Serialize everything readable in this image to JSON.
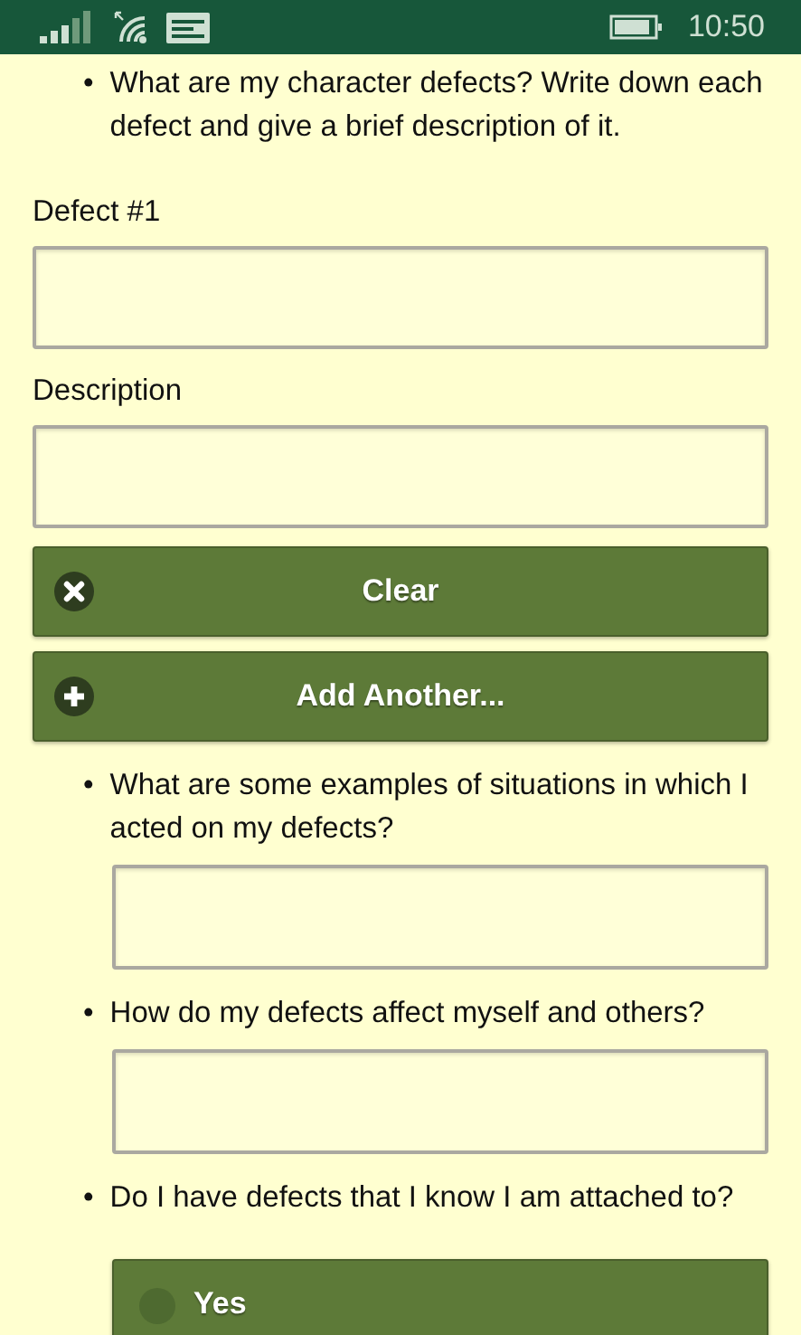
{
  "status_bar": {
    "time": "10:50"
  },
  "intro": {
    "bullet": "•",
    "text": "What are my character defects? Write down each defect and give a brief description of it."
  },
  "fields": [
    {
      "label": "Defect #1"
    },
    {
      "label": "Description"
    }
  ],
  "buttons": [
    {
      "kind": "clear",
      "label": "Clear"
    },
    {
      "kind": "add",
      "label": "Add Another..."
    }
  ],
  "questions": [
    {
      "bullet": "•",
      "text": "What are some examples of situations in which I acted on my defects?",
      "kind": "text"
    },
    {
      "bullet": "•",
      "text": "How do my defects affect myself and others?",
      "kind": "text"
    },
    {
      "bullet": "•",
      "text": "Do I have defects that I know I am attached to?",
      "kind": "choice",
      "options": [
        {
          "label": "Yes",
          "selected": false
        }
      ]
    }
  ]
}
